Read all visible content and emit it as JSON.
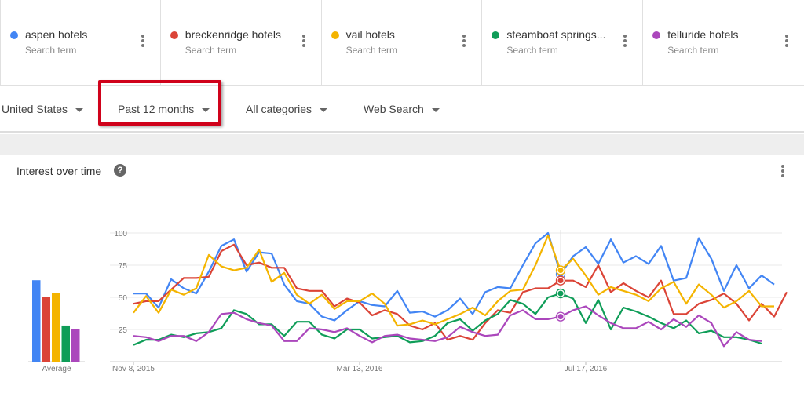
{
  "terms": [
    {
      "name": "aspen hotels",
      "sub": "Search term",
      "color": "#4285f4"
    },
    {
      "name": "breckenridge hotels",
      "sub": "Search term",
      "color": "#db4437"
    },
    {
      "name": "vail hotels",
      "sub": "Search term",
      "color": "#f4b400"
    },
    {
      "name": "steamboat springs...",
      "sub": "Search term",
      "color": "#0f9d58"
    },
    {
      "name": "telluride hotels",
      "sub": "Search term",
      "color": "#ab47bc"
    }
  ],
  "filters": {
    "region": "United States",
    "period": "Past 12 months",
    "category": "All categories",
    "property": "Web Search"
  },
  "card": {
    "title": "Interest over time",
    "help_glyph": "?"
  },
  "chart_data": {
    "type": "line",
    "title": "Interest over time",
    "ylim": [
      0,
      100
    ],
    "yticks": [
      25,
      50,
      75,
      100
    ],
    "grid": true,
    "x_labels": [
      {
        "label": "Nov 8, 2015",
        "index": 0
      },
      {
        "label": "Mar 13, 2016",
        "index": 18
      },
      {
        "label": "Jul 17, 2016",
        "index": 36
      }
    ],
    "highlight_index": 34,
    "series": [
      {
        "name": "aspen hotels",
        "color": "#4285f4",
        "values": [
          53,
          53,
          42,
          64,
          57,
          53,
          70,
          90,
          95,
          70,
          85,
          84,
          60,
          47,
          45,
          35,
          32,
          40,
          47,
          44,
          43,
          55,
          38,
          39,
          35,
          40,
          49,
          37,
          54,
          58,
          57,
          75,
          92,
          100,
          68,
          82,
          89,
          76,
          95,
          77,
          82,
          76,
          90,
          63,
          65,
          96,
          80,
          55,
          75,
          57,
          67,
          60
        ]
      },
      {
        "name": "breckenridge hotels",
        "color": "#db4437",
        "values": [
          45,
          47,
          47,
          56,
          65,
          65,
          66,
          86,
          91,
          75,
          77,
          73,
          73,
          57,
          55,
          55,
          43,
          49,
          46,
          36,
          40,
          37,
          28,
          25,
          30,
          17,
          20,
          17,
          30,
          40,
          38,
          54,
          57,
          57,
          63,
          63,
          58,
          75,
          54,
          61,
          55,
          50,
          63,
          37,
          37,
          45,
          48,
          53,
          45,
          32,
          45,
          35,
          54
        ]
      },
      {
        "name": "vail hotels",
        "color": "#f4b400",
        "values": [
          38,
          51,
          38,
          56,
          52,
          57,
          83,
          74,
          71,
          73,
          87,
          62,
          69,
          52,
          45,
          52,
          41,
          47,
          47,
          53,
          45,
          28,
          29,
          32,
          29,
          33,
          37,
          42,
          36,
          47,
          55,
          56,
          75,
          98,
          71,
          80,
          67,
          52,
          58,
          55,
          52,
          47,
          57,
          62,
          45,
          60,
          52,
          42,
          47,
          55,
          43,
          43
        ]
      },
      {
        "name": "steamboat springs...",
        "color": "#0f9d58",
        "values": [
          13,
          17,
          17,
          21,
          19,
          22,
          23,
          26,
          40,
          37,
          29,
          29,
          20,
          31,
          31,
          21,
          18,
          25,
          25,
          18,
          19,
          20,
          15,
          16,
          20,
          30,
          33,
          24,
          32,
          37,
          48,
          45,
          37,
          50,
          53,
          49,
          30,
          48,
          25,
          42,
          39,
          35,
          30,
          26,
          32,
          22,
          24,
          19,
          19,
          17,
          14
        ]
      },
      {
        "name": "telluride hotels",
        "color": "#ab47bc",
        "values": [
          20,
          19,
          16,
          20,
          20,
          16,
          23,
          37,
          38,
          33,
          30,
          28,
          16,
          16,
          26,
          25,
          23,
          26,
          20,
          15,
          20,
          21,
          18,
          17,
          16,
          19,
          27,
          23,
          20,
          21,
          36,
          40,
          33,
          33,
          35,
          40,
          43,
          36,
          30,
          26,
          26,
          31,
          25,
          33,
          27,
          36,
          30,
          12,
          23,
          17,
          16
        ]
      }
    ]
  }
}
